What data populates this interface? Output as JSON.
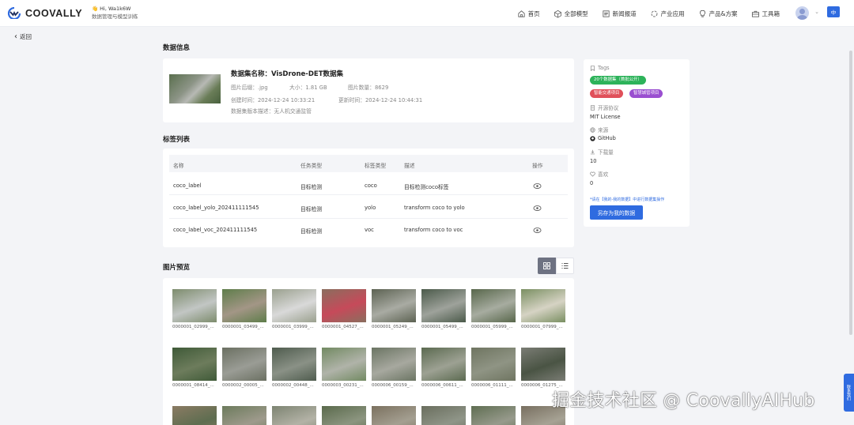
{
  "brand": {
    "name": "COOVALLY"
  },
  "greeting": {
    "line1": "Hi, Wa1k6W",
    "line2": "数据管理与模型训练"
  },
  "nav": [
    {
      "label": "首页",
      "icon": "home-icon"
    },
    {
      "label": "全部模型",
      "icon": "cube-icon"
    },
    {
      "label": "新闻报道",
      "icon": "news-icon"
    },
    {
      "label": "产业应用",
      "icon": "industry-icon"
    },
    {
      "label": "产品&方案",
      "icon": "bulb-icon"
    },
    {
      "label": "工具箱",
      "icon": "toolbox-icon"
    }
  ],
  "lang": {
    "label": "中"
  },
  "back": {
    "label": "返回"
  },
  "info": {
    "section_title": "数据信息",
    "name": "数据集名称：VisDrone-DET数据集",
    "format_label": "图片后缀：",
    "format": ".jpg",
    "size_label": "大小：",
    "size": "1.81 GB",
    "count_label": "图片数量：",
    "count": "8629",
    "created_label": "创建时间：",
    "created": "2024-12-24 10:33:21",
    "updated_label": "更新时间：",
    "updated": "2024-12-24 10:44:31",
    "desc_label": "数据集版本描述：",
    "desc": "无人机交通监管"
  },
  "labels": {
    "section_title": "标签列表",
    "columns": [
      "名称",
      "任务类型",
      "标签类型",
      "描述",
      "操作"
    ],
    "rows": [
      {
        "name": "coco_label",
        "task": "目标检测",
        "type": "coco",
        "desc": "目标检测coco标签"
      },
      {
        "name": "coco_label_yolo_202411111545",
        "task": "目标检测",
        "type": "yolo",
        "desc": "transform coco to yolo"
      },
      {
        "name": "coco_label_voc_202411111545",
        "task": "目标检测",
        "type": "voc",
        "desc": "transform coco to voc"
      }
    ]
  },
  "preview": {
    "section_title": "图片预览",
    "images": [
      "0000001_02999_...",
      "0000001_03499_...",
      "0000001_03999_...",
      "0000001_04527_...",
      "0000001_05249_...",
      "0000001_05499_...",
      "0000001_05999_...",
      "0000001_07999_...",
      "0000001_08414_...",
      "0000002_00005_...",
      "0000002_00448_...",
      "0000003_00231_...",
      "0000006_00159_...",
      "0000006_00611_...",
      "0000006_01111_...",
      "0000006_01275_...",
      "",
      "",
      "",
      "",
      "",
      "",
      "",
      ""
    ],
    "image_colors": [
      [
        "#7d8c6d",
        "#c2c6c4"
      ],
      [
        "#5e7d4a",
        "#a39686"
      ],
      [
        "#9aa08e",
        "#d9d9d9"
      ],
      [
        "#8a6e5e",
        "#c64a5a"
      ],
      [
        "#5c6252",
        "#a9aba3"
      ],
      [
        "#4b5a4a",
        "#9ea29b"
      ],
      [
        "#58674b",
        "#a7aca0"
      ],
      [
        "#7a8f62",
        "#d6d3c4"
      ],
      [
        "#3f5a38",
        "#6d7c5c"
      ],
      [
        "#6b7062",
        "#9a9c95"
      ],
      [
        "#4f5c4e",
        "#8a9186"
      ],
      [
        "#728a62",
        "#b0b3a9"
      ],
      [
        "#6b7563",
        "#a7a89f"
      ],
      [
        "#5b6a50",
        "#9da193"
      ],
      [
        "#6f7561",
        "#8f9484"
      ],
      [
        "#7a7c74",
        "#4a5444"
      ],
      [
        "#8b7b63",
        "#5e6d50"
      ],
      [
        "#6c7b5c",
        "#9e9a8c"
      ],
      [
        "#7d8472",
        "#b3b2a6"
      ],
      [
        "#5a6a4c",
        "#8c9580"
      ],
      [
        "#7b715f",
        "#a49f91"
      ],
      [
        "#6a6e5e",
        "#8f9588"
      ],
      [
        "#5f6e52",
        "#979a8c"
      ],
      [
        "#786f60",
        "#a6a294"
      ]
    ]
  },
  "panel": {
    "tags_label": "Tags",
    "tags": [
      {
        "text": "20个数据集（首批公开）",
        "color": "#2db35a"
      },
      {
        "text": "智能交通项目",
        "color": "#e0505a"
      },
      {
        "text": "智慧城管项目",
        "color": "#9a4fd0"
      }
    ],
    "license_label": "开源协议",
    "license": "MIT License",
    "source_label": "来源",
    "source": "GitHub",
    "downloads_label": "下载量",
    "downloads": "10",
    "likes_label": "喜欢",
    "likes": "0",
    "note": "*请在【我的-我的数据】中进行数据集操作",
    "button": "另存为我的数据"
  },
  "watermark": "掘金技术社区 @ CoovallyAIHub",
  "float_btn": "联系我们"
}
